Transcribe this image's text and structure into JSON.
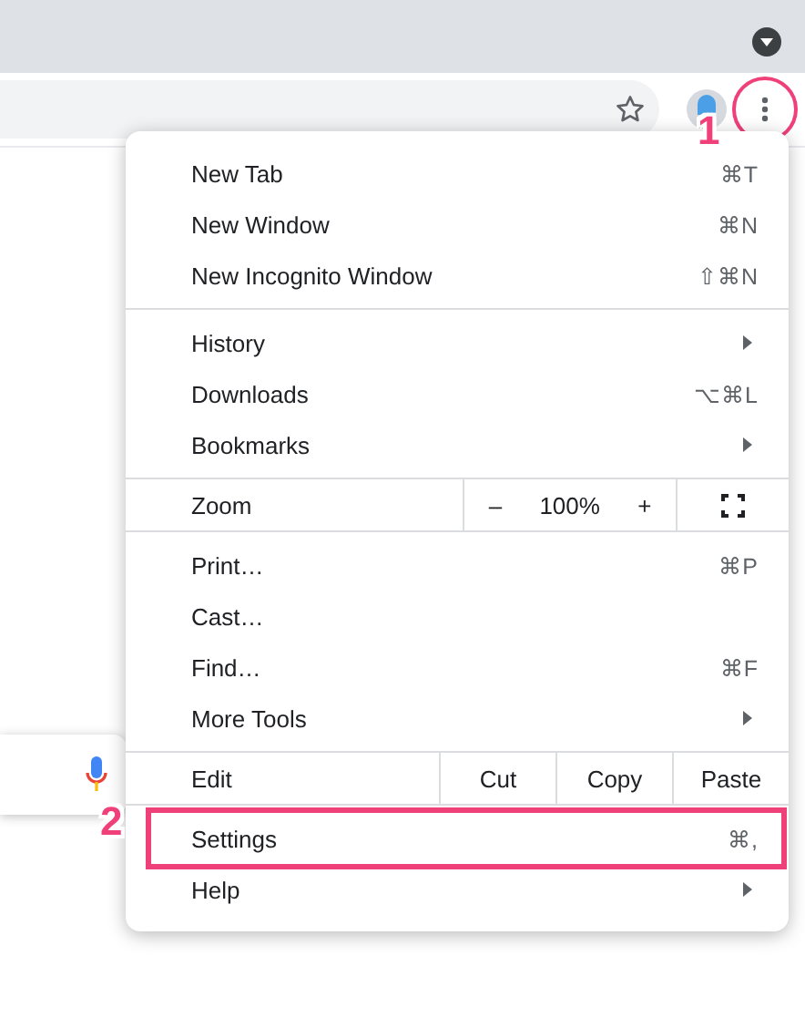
{
  "toolbar": {
    "menu_button_circled": true
  },
  "menu": {
    "sections": [
      [
        {
          "kind": "item",
          "label": "New Tab",
          "shortcut": "⌘T",
          "submenu": false,
          "highlighted": false
        },
        {
          "kind": "item",
          "label": "New Window",
          "shortcut": "⌘N",
          "submenu": false,
          "highlighted": false
        },
        {
          "kind": "item",
          "label": "New Incognito Window",
          "shortcut": "⇧⌘N",
          "submenu": false,
          "highlighted": false
        }
      ],
      [
        {
          "kind": "item",
          "label": "History",
          "submenu": true,
          "highlighted": false
        },
        {
          "kind": "item",
          "label": "Downloads",
          "shortcut": "⌥⌘L",
          "submenu": false,
          "highlighted": false
        },
        {
          "kind": "item",
          "label": "Bookmarks",
          "submenu": true,
          "highlighted": false
        }
      ],
      [
        {
          "kind": "zoom",
          "label": "Zoom",
          "minus": "–",
          "value": "100%",
          "plus": "+"
        }
      ],
      [
        {
          "kind": "item",
          "label": "Print…",
          "shortcut": "⌘P",
          "submenu": false,
          "highlighted": false
        },
        {
          "kind": "item",
          "label": "Cast…",
          "submenu": false,
          "highlighted": false
        },
        {
          "kind": "item",
          "label": "Find…",
          "shortcut": "⌘F",
          "submenu": false,
          "highlighted": false
        },
        {
          "kind": "item",
          "label": "More Tools",
          "submenu": true,
          "highlighted": false
        }
      ],
      [
        {
          "kind": "edit",
          "label": "Edit",
          "actions": [
            "Cut",
            "Copy",
            "Paste"
          ]
        }
      ],
      [
        {
          "kind": "item",
          "label": "Settings",
          "shortcut": "⌘,",
          "submenu": false,
          "highlighted": true
        },
        {
          "kind": "item",
          "label": "Help",
          "submenu": true,
          "highlighted": false
        }
      ]
    ]
  },
  "callouts": [
    {
      "label": "1"
    },
    {
      "label": "2"
    }
  ]
}
